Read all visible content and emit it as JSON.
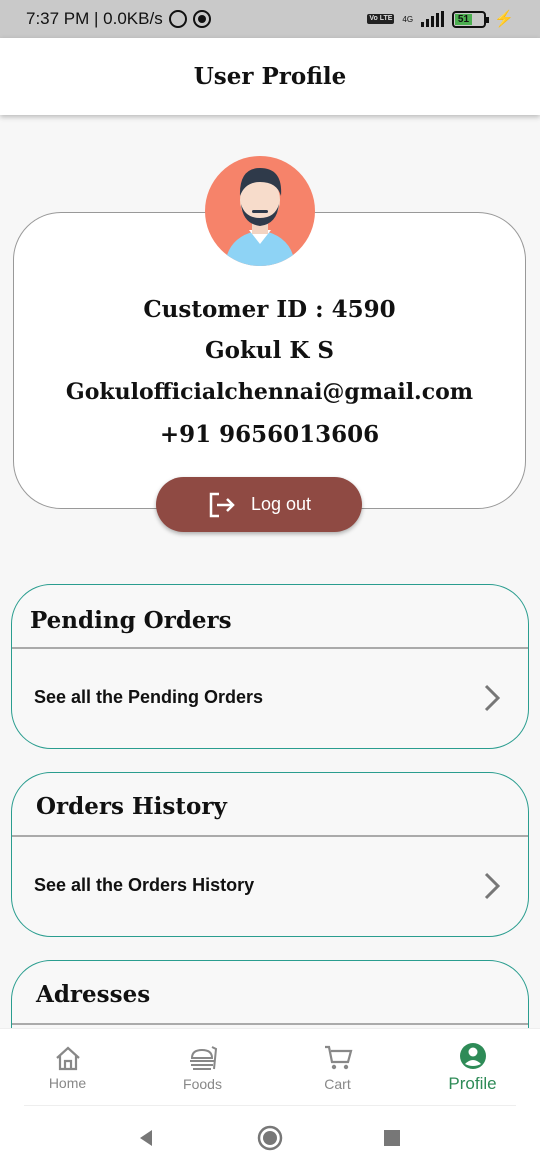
{
  "status_bar": {
    "time_speed": "7:37 PM | 0.0KB/s",
    "network": "4G",
    "volte": "Vo LTE",
    "battery": "51"
  },
  "app_bar": {
    "title": "User Profile"
  },
  "profile": {
    "customer_id": "Customer ID : 4590",
    "name": "Gokul K S",
    "email": "Gokulofficialchennai@gmail.com",
    "phone": "+91 9656013606",
    "logout_label": "Log out"
  },
  "sections": [
    {
      "title": "Pending Orders",
      "link": "See all the Pending Orders"
    },
    {
      "title": "Orders History",
      "link": "See all the  Orders History"
    },
    {
      "title": "Adresses"
    }
  ],
  "bottom_nav": [
    {
      "label": "Home",
      "icon": "home-icon"
    },
    {
      "label": "Foods",
      "icon": "foods-icon"
    },
    {
      "label": "Cart",
      "icon": "cart-icon"
    },
    {
      "label": "Profile",
      "icon": "profile-icon",
      "active": true
    }
  ],
  "colors": {
    "accent": "#2e8b57",
    "logout": "#8f4a43",
    "card_border": "#2a9d8f",
    "avatar_bg": "#f6836a"
  }
}
